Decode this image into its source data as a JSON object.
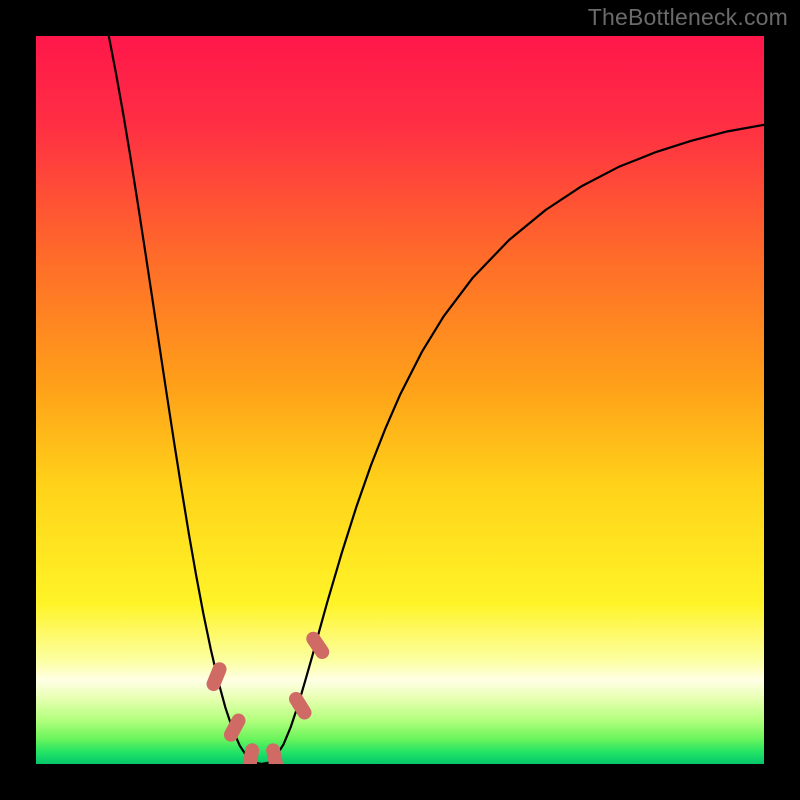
{
  "attribution": "TheBottleneck.com",
  "chart_data": {
    "type": "line",
    "title": "",
    "xlabel": "",
    "ylabel": "",
    "xlim": [
      0,
      100
    ],
    "ylim": [
      0,
      100
    ],
    "background_gradient": {
      "stops": [
        {
          "offset": 0.0,
          "color": "#ff174a"
        },
        {
          "offset": 0.12,
          "color": "#ff2e44"
        },
        {
          "offset": 0.3,
          "color": "#ff6a2a"
        },
        {
          "offset": 0.48,
          "color": "#ffa019"
        },
        {
          "offset": 0.62,
          "color": "#ffd319"
        },
        {
          "offset": 0.78,
          "color": "#fff428"
        },
        {
          "offset": 0.86,
          "color": "#fcffa6"
        },
        {
          "offset": 0.885,
          "color": "#ffffe5"
        },
        {
          "offset": 0.91,
          "color": "#e7ffb0"
        },
        {
          "offset": 0.94,
          "color": "#b2ff7d"
        },
        {
          "offset": 0.965,
          "color": "#6cf55c"
        },
        {
          "offset": 0.985,
          "color": "#1fe265"
        },
        {
          "offset": 1.0,
          "color": "#06c66b"
        }
      ]
    },
    "series": [
      {
        "name": "bottleneck-curve",
        "stroke": "#000000",
        "stroke_width": 2.2,
        "points": [
          {
            "x": 10.0,
            "y": 100.0
          },
          {
            "x": 11.0,
            "y": 94.8
          },
          {
            "x": 12.0,
            "y": 89.2
          },
          {
            "x": 13.0,
            "y": 83.2
          },
          {
            "x": 14.0,
            "y": 76.9
          },
          {
            "x": 15.0,
            "y": 70.4
          },
          {
            "x": 16.0,
            "y": 63.8
          },
          {
            "x": 17.0,
            "y": 57.1
          },
          {
            "x": 18.0,
            "y": 50.5
          },
          {
            "x": 19.0,
            "y": 44.0
          },
          {
            "x": 20.0,
            "y": 37.7
          },
          {
            "x": 21.0,
            "y": 31.6
          },
          {
            "x": 22.0,
            "y": 25.9
          },
          {
            "x": 23.0,
            "y": 20.6
          },
          {
            "x": 24.0,
            "y": 15.8
          },
          {
            "x": 25.0,
            "y": 11.5
          },
          {
            "x": 26.0,
            "y": 7.8
          },
          {
            "x": 27.0,
            "y": 4.8
          },
          {
            "x": 28.0,
            "y": 2.5
          },
          {
            "x": 29.0,
            "y": 1.0
          },
          {
            "x": 30.0,
            "y": 0.2
          },
          {
            "x": 31.0,
            "y": 0.0
          },
          {
            "x": 32.0,
            "y": 0.2
          },
          {
            "x": 33.0,
            "y": 1.1
          },
          {
            "x": 34.0,
            "y": 2.7
          },
          {
            "x": 35.0,
            "y": 5.1
          },
          {
            "x": 36.0,
            "y": 8.1
          },
          {
            "x": 37.0,
            "y": 11.5
          },
          {
            "x": 38.0,
            "y": 15.0
          },
          {
            "x": 39.0,
            "y": 18.6
          },
          {
            "x": 40.0,
            "y": 22.2
          },
          {
            "x": 42.0,
            "y": 29.0
          },
          {
            "x": 44.0,
            "y": 35.3
          },
          {
            "x": 46.0,
            "y": 41.0
          },
          {
            "x": 48.0,
            "y": 46.1
          },
          {
            "x": 50.0,
            "y": 50.7
          },
          {
            "x": 53.0,
            "y": 56.6
          },
          {
            "x": 56.0,
            "y": 61.5
          },
          {
            "x": 60.0,
            "y": 66.8
          },
          {
            "x": 65.0,
            "y": 72.0
          },
          {
            "x": 70.0,
            "y": 76.1
          },
          {
            "x": 75.0,
            "y": 79.4
          },
          {
            "x": 80.0,
            "y": 82.0
          },
          {
            "x": 85.0,
            "y": 84.0
          },
          {
            "x": 90.0,
            "y": 85.6
          },
          {
            "x": 95.0,
            "y": 86.9
          },
          {
            "x": 100.0,
            "y": 87.8
          }
        ]
      }
    ],
    "markers": {
      "name": "bottom-markers",
      "color": "#cf6a64",
      "shape": "rounded-rect",
      "points": [
        {
          "x": 24.8,
          "y": 12.0,
          "rot": 22
        },
        {
          "x": 27.3,
          "y": 5.0,
          "rot": 28
        },
        {
          "x": 29.5,
          "y": 0.8,
          "rot": 10
        },
        {
          "x": 32.8,
          "y": 0.8,
          "rot": -12
        },
        {
          "x": 36.3,
          "y": 8.0,
          "rot": -32
        },
        {
          "x": 38.7,
          "y": 16.3,
          "rot": -34
        }
      ]
    }
  }
}
